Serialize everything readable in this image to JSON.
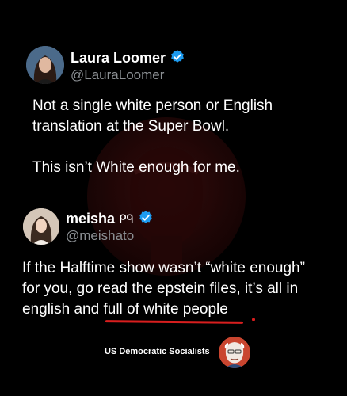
{
  "tweet1": {
    "name": "Laura Loomer",
    "handle": "@LauraLoomer",
    "paragraphs": [
      "Not a single white person or English translation at the Super Bowl.",
      "This isn’t White enough for me."
    ]
  },
  "tweet2": {
    "name": "meisha",
    "name_suffix": "ᑭᑫ",
    "handle": "@meishato",
    "text_line1": "If the Halftime show wasn’t “white enough”",
    "text_line2": "for you, go read the epstein files, it’s all in",
    "text_line3_a": "english and ",
    "text_line3_b": "full of white people"
  },
  "footer": {
    "label": "US Democratic Socialists"
  },
  "colors": {
    "background": "#000000",
    "verified_blue": "#1d9bf0",
    "handle_gray": "#8b8f93",
    "underline_red": "#d81e1e"
  },
  "icons": [
    "verified-badge-icon",
    "avatar",
    "bernie-watermark",
    "dsa-logo"
  ]
}
